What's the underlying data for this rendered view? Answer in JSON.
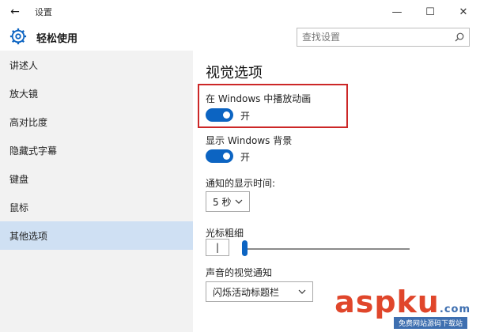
{
  "window": {
    "back_glyph": "←",
    "title": "设置",
    "minimize_glyph": "—",
    "maximize_glyph": "☐",
    "close_glyph": "✕"
  },
  "header": {
    "icon": "gear-icon",
    "title": "轻松使用",
    "search_placeholder": "查找设置",
    "search_icon": "search-icon"
  },
  "sidebar": {
    "items": [
      {
        "label": "讲述人",
        "selected": false
      },
      {
        "label": "放大镜",
        "selected": false
      },
      {
        "label": "高对比度",
        "selected": false
      },
      {
        "label": "隐藏式字幕",
        "selected": false
      },
      {
        "label": "键盘",
        "selected": false
      },
      {
        "label": "鼠标",
        "selected": false
      },
      {
        "label": "其他选项",
        "selected": true
      }
    ],
    "selected_color": "#cfe0f3"
  },
  "content": {
    "section_title": "视觉选项",
    "animations": {
      "label": "在 Windows 中播放动画",
      "state": "开",
      "on": true
    },
    "background": {
      "label": "显示 Windows 背景",
      "state": "开",
      "on": true
    },
    "notify_time": {
      "label": "通知的显示时间:",
      "value": "5 秒"
    },
    "cursor_width": {
      "label": "光标粗细",
      "preview": "|",
      "level": 0.0
    },
    "visual_notify": {
      "label": "声音的视觉通知",
      "value": "闪烁活动标题栏"
    }
  },
  "colors": {
    "accent": "#0c64c2",
    "highlight_border": "#cc2727",
    "sidebar_bg": "#f2f2f2"
  },
  "watermark": {
    "text": "aspku",
    "suffix": ".com",
    "sub": "免费网站源码下载站"
  }
}
